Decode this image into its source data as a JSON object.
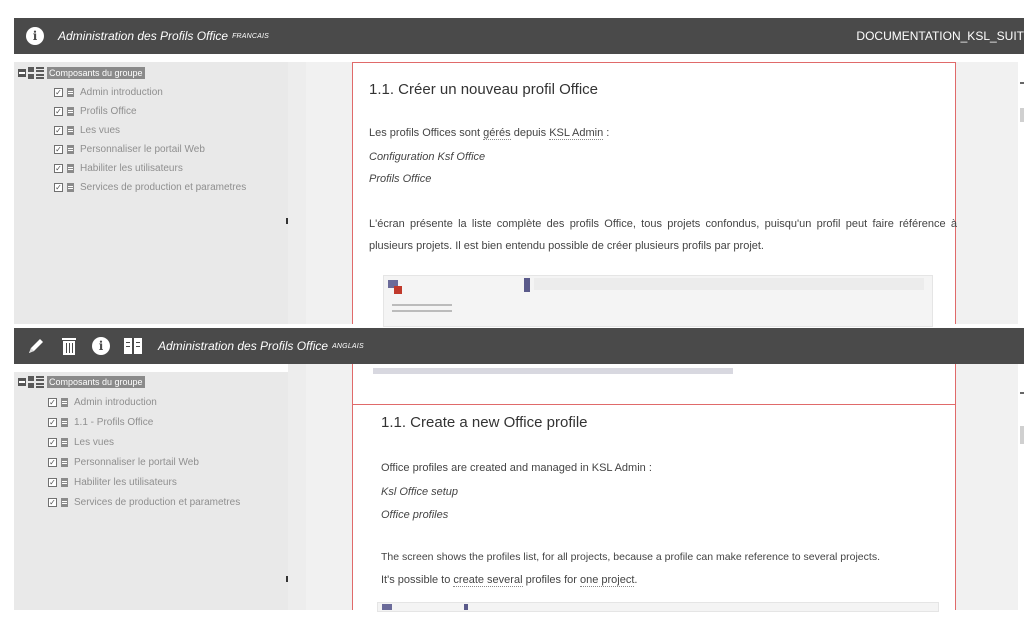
{
  "top_panel": {
    "title": "Administration des Profils Office",
    "lang": "FRANCAIS",
    "doc_name": "DOCUMENTATION_KSL_SUIT",
    "tree_root": "Composants du groupe",
    "tree_items": [
      "Admin introduction",
      "Profils Office",
      "Les vues",
      "Personnaliser le portail Web",
      "Habiliter les utilisateurs",
      "Services de production et parametres"
    ],
    "heading": "1.1. Créer un nouveau profil Office",
    "intro_prefix": "Les profils Offices sont ",
    "intro_ul1": "gérés",
    "intro_mid": " depuis ",
    "intro_ul2": "KSL Admin",
    "intro_suffix": " :",
    "menu_1": "Configuration Ksf Office",
    "menu_2": "Profils Office",
    "paragraph": "L'écran présente la liste complète des profils Office, tous projets confondus, puisqu'un profil peut faire référence à plusieurs projets. Il est bien entendu possible de créer plusieurs profils par projet."
  },
  "bottom_panel": {
    "title": "Administration des Profils Office",
    "lang": "ANGLAIS",
    "tree_root": "Composants du groupe",
    "tree_items": [
      "Admin introduction",
      "1.1 - Profils Office",
      "Les vues",
      "Personnaliser le portail Web",
      "Habiliter les utilisateurs",
      "Services de production et parametres"
    ],
    "heading": "1.1. Create a new Office profile",
    "intro": "Office profiles are created and managed in KSL Admin :",
    "menu_1": "Ksl Office setup",
    "menu_2": "Office profiles",
    "para_line1": "The screen shows the profiles list, for all projects, because a profile can make reference to several projects.",
    "para_line2_prefix": "It's possible to ",
    "para_line2_ul": "create several",
    "para_line2_mid": " profiles for ",
    "para_line2_ul2": "one project",
    "para_line2_suffix": "."
  }
}
